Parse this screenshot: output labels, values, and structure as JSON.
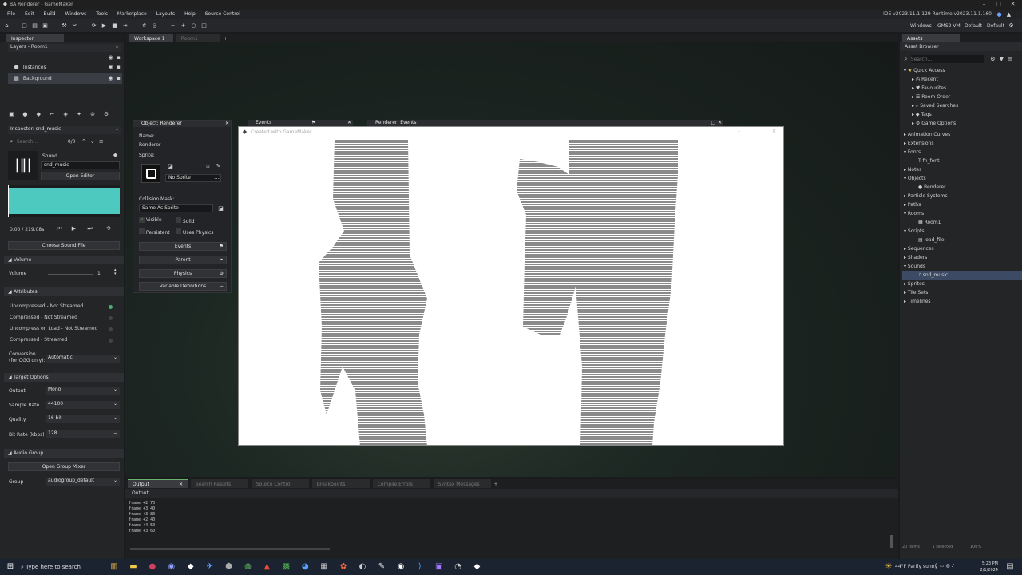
{
  "window": {
    "title": "BA Renderer - GameMaker"
  },
  "menu": [
    "File",
    "Edit",
    "Build",
    "Windows",
    "Tools",
    "Marketplace",
    "Layouts",
    "Help",
    "Source Control"
  ],
  "ide_version": "IDE v2023.11.1.129  Runtime v2023.11.1.160",
  "target": {
    "platform": "Windows",
    "vm": "GMS2 VM",
    "config1": "Default",
    "config2": "Default"
  },
  "inspector": {
    "tab": "Inspector",
    "layers_title": "Layers - Room1",
    "layers": [
      "Instances",
      "Background"
    ],
    "inspector_title": "Inspector: snd_music",
    "search_placeholder": "Search...",
    "page": "0/0",
    "sound_label": "Sound",
    "sound_name": "snd_music",
    "open_editor": "Open Editor",
    "time": "0.00 / 219.08s",
    "choose_file": "Choose Sound File",
    "volume_section": "Volume",
    "volume_label": "Volume",
    "volume_value": "1",
    "attributes_section": "Attributes",
    "attributes": [
      {
        "label": "Uncompressed - Not Streamed",
        "selected": true
      },
      {
        "label": "Compressed - Not Streamed",
        "selected": false
      },
      {
        "label": "Uncompress on Load - Not Streamed",
        "selected": false
      },
      {
        "label": "Compressed - Streamed",
        "selected": false
      }
    ],
    "conversion_label": "Conversion (for OGG only):",
    "conversion_value": "Automatic",
    "target_section": "Target Options",
    "output_label": "Output",
    "output_value": "Mono",
    "sample_label": "Sample Rate",
    "sample_value": "44100",
    "quality_label": "Quality",
    "quality_value": "16 bit",
    "bitrate_label": "Bit Rate (kbps)",
    "bitrate_value": "128",
    "audio_group_section": "Audio Group",
    "open_group_mixer": "Open Group Mixer",
    "group_label": "Group",
    "group_value": "audiogroup_default"
  },
  "workspace": {
    "tab": "Workspace 1",
    "tab2": "Room1"
  },
  "object_panel": {
    "title": "Object: Renderer",
    "name_label": "Name:",
    "name_value": "Renderer",
    "sprite_label": "Sprite:",
    "sprite_value": "No Sprite",
    "collision_label": "Collision Mask:",
    "collision_value": "Same As Sprite",
    "visible": "Visible",
    "solid": "Solid",
    "persistent": "Persistent",
    "uses_physics": "Uses Physics",
    "buttons": [
      "Events",
      "Parent",
      "Physics",
      "Variable Definitions"
    ]
  },
  "events_panel": {
    "title": "Events"
  },
  "renderer_events_panel": {
    "title": "Renderer: Events"
  },
  "game_window": {
    "title": "Created with GameMaker"
  },
  "assets": {
    "tab": "Assets",
    "browser_label": "Asset Browser",
    "search_placeholder": "Search...",
    "quick_access": "Quick Access",
    "quick_items": [
      "Recent",
      "Favourites",
      "Room Order",
      "Saved Searches",
      "Tags",
      "Game Options"
    ],
    "tree": [
      {
        "label": "Animation Curves",
        "level": 0
      },
      {
        "label": "Extensions",
        "level": 0
      },
      {
        "label": "Fonts",
        "level": 0
      },
      {
        "label": "fn_font",
        "level": 1
      },
      {
        "label": "Notes",
        "level": 0
      },
      {
        "label": "Objects",
        "level": 0
      },
      {
        "label": "Renderer",
        "level": 1
      },
      {
        "label": "Particle Systems",
        "level": 0
      },
      {
        "label": "Paths",
        "level": 0
      },
      {
        "label": "Rooms",
        "level": 0
      },
      {
        "label": "Room1",
        "level": 1
      },
      {
        "label": "Scripts",
        "level": 0
      },
      {
        "label": "load_file",
        "level": 1
      },
      {
        "label": "Sequences",
        "level": 0
      },
      {
        "label": "Shaders",
        "level": 0
      },
      {
        "label": "Sounds",
        "level": 0
      },
      {
        "label": "snd_music",
        "level": 1,
        "selected": true
      },
      {
        "label": "Sprites",
        "level": 0
      },
      {
        "label": "Tile Sets",
        "level": 0
      },
      {
        "label": "Timelines",
        "level": 0
      }
    ],
    "status_left": "20 items",
    "status_mid": "1 selected",
    "status_zoom": "100%"
  },
  "output": {
    "tabs": [
      "Output",
      "Search Results",
      "Source Control",
      "Breakpoints",
      "Compile Errors",
      "Syntax Messages"
    ],
    "title": "Output",
    "lines": [
      "frame +2.70",
      "frame +3.40",
      "frame +3.80",
      "frame +2.40",
      "frame +4.50",
      "frame +3.60"
    ]
  },
  "taskbar": {
    "search_placeholder": "Type here to search",
    "weather": "44°F  Partly sunny",
    "time": "5:23 PM",
    "date": "2/1/2024"
  },
  "colors": {
    "accent": "#69b36b",
    "waveform": "#4ec9c0",
    "background": "#1a1b1d"
  }
}
